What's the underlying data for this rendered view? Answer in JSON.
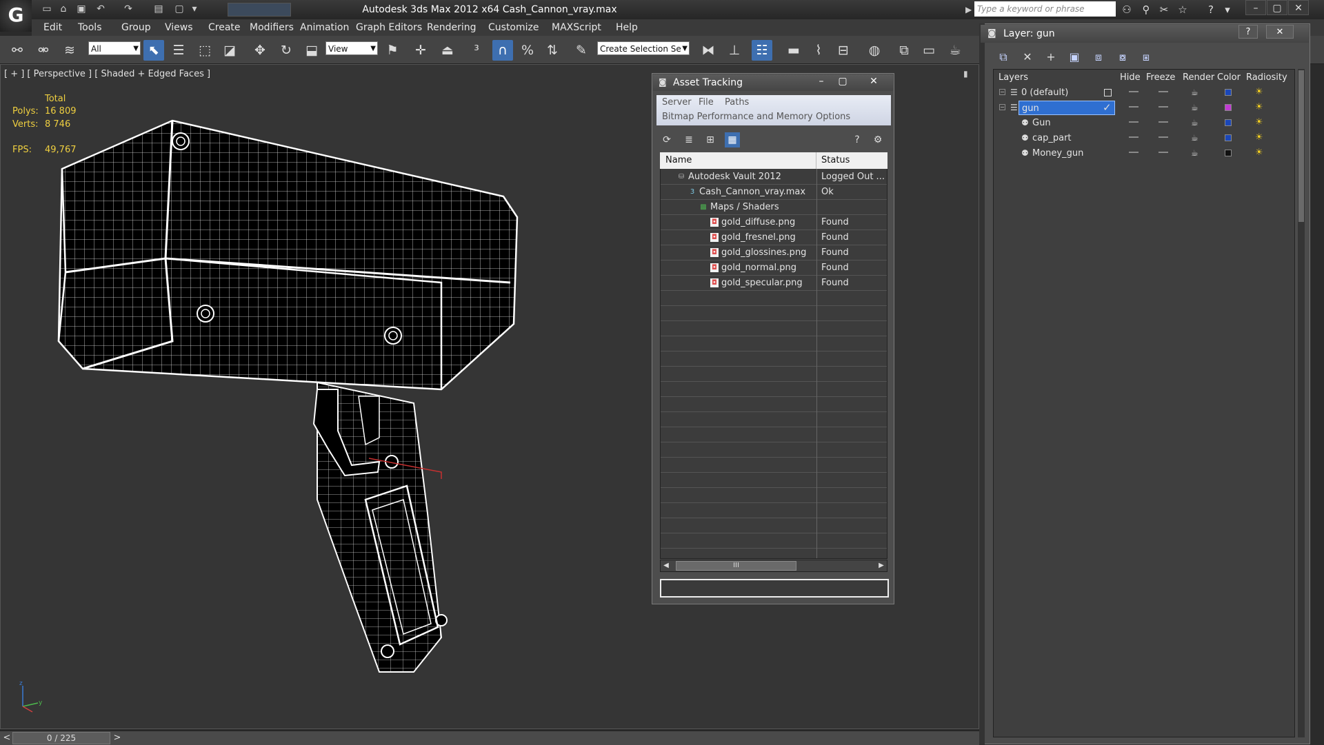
{
  "window": {
    "title": "Autodesk 3ds Max  2012 x64    Cash_Cannon_vray.max",
    "search_placeholder": "Type a keyword or phrase",
    "app_logo": "G"
  },
  "menu": [
    "Edit",
    "Tools",
    "Group",
    "Views",
    "Create",
    "Modifiers",
    "Animation",
    "Graph Editors",
    "Rendering",
    "Customize",
    "MAXScript",
    "Help"
  ],
  "toolbar": {
    "selection_filter": "All",
    "ref_coord": "View",
    "selection_set": "Create Selection Se"
  },
  "viewport": {
    "label": "[ + ] [ Perspective ] [ Shaded + Edged Faces ]",
    "stats": {
      "total_label": "Total",
      "polys_label": "Polys:",
      "polys_value": "16 809",
      "verts_label": "Verts:",
      "verts_value": "8 746",
      "fps_label": "FPS:",
      "fps_value": "49,767"
    },
    "timeline": "0 / 225",
    "arrow_left": "<",
    "arrow_right": ">"
  },
  "asset_tracking": {
    "title": "Asset Tracking",
    "menu_row1": [
      "Server",
      "File",
      "Paths"
    ],
    "menu_row2": [
      "Bitmap Performance and Memory",
      "Options"
    ],
    "columns": [
      "Name",
      "Status"
    ],
    "rows": [
      {
        "name": "Autodesk Vault 2012",
        "status": "Logged Out ...",
        "indent": 0,
        "icon": "vault-icon"
      },
      {
        "name": "Cash_Cannon_vray.max",
        "status": "Ok",
        "indent": 1,
        "icon": "max-file-icon"
      },
      {
        "name": "Maps / Shaders",
        "status": "",
        "indent": 2,
        "icon": "maps-icon"
      },
      {
        "name": "gold_diffuse.png",
        "status": "Found",
        "indent": 3,
        "icon": "image-file-icon"
      },
      {
        "name": "gold_fresnel.png",
        "status": "Found",
        "indent": 3,
        "icon": "image-file-icon"
      },
      {
        "name": "gold_glossines.png",
        "status": "Found",
        "indent": 3,
        "icon": "image-file-icon"
      },
      {
        "name": "gold_normal.png",
        "status": "Found",
        "indent": 3,
        "icon": "image-file-icon"
      },
      {
        "name": "gold_specular.png",
        "status": "Found",
        "indent": 3,
        "icon": "image-file-icon"
      }
    ],
    "empty_rows": 18,
    "scroll_grip": "III"
  },
  "layer_window": {
    "title": "Layer: gun",
    "columns": [
      "Layers",
      "Hide",
      "Freeze",
      "Render",
      "Color",
      "Radiosity"
    ],
    "rows": [
      {
        "name": "0 (default)",
        "kind": "layer",
        "indent": 0,
        "color": "#1b47b8",
        "selected": false,
        "current": "box"
      },
      {
        "name": "gun",
        "kind": "layer",
        "indent": 0,
        "color": "#c23bd4",
        "selected": true,
        "current": "check"
      },
      {
        "name": "Gun",
        "kind": "object",
        "indent": 1,
        "color": "#1b47b8",
        "selected": false,
        "current": ""
      },
      {
        "name": "cap_part",
        "kind": "object",
        "indent": 1,
        "color": "#1b47b8",
        "selected": false,
        "current": ""
      },
      {
        "name": "Money_gun",
        "kind": "object",
        "indent": 1,
        "color": "#111111",
        "selected": false,
        "current": ""
      }
    ],
    "check_mark": "✓",
    "help_glyph": "?",
    "close_glyph": "✕"
  },
  "colors": {
    "selection_blue": "#3e6fb0",
    "stat_yellow": "#f0d040",
    "wire_white": "#ffffff"
  }
}
